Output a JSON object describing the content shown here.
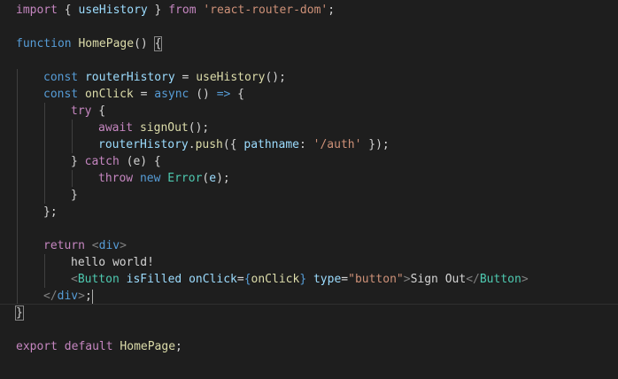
{
  "colors": {
    "background": "#1e1e1e",
    "keyword": "#569cd6",
    "control": "#c586c0",
    "variable": "#9cdcfe",
    "function": "#dcdcaa",
    "string": "#ce9178",
    "class": "#4ec9b0",
    "tag_bracket": "#808080",
    "plain": "#d4d4d4"
  },
  "code": {
    "l1": {
      "kw": "import",
      "p1": " { ",
      "fn": "useHistory",
      "p2": " } ",
      "kw2": "from",
      "sp": " ",
      "str": "'react-router-dom'",
      "end": ";"
    },
    "l3": {
      "kw": "function",
      "sp": " ",
      "fn": "HomePage",
      "p": "() ",
      "brace": "{"
    },
    "l5": {
      "kw": "const",
      "sp": " ",
      "var": "routerHistory",
      "eq": " = ",
      "fn": "useHistory",
      "end": "();"
    },
    "l6": {
      "kw": "const",
      "sp": " ",
      "var": "onClick",
      "eq": " = ",
      "kw2": "async",
      "arrow_pre": " () ",
      "arrow": "=>",
      "brace": " {"
    },
    "l7": {
      "kw": "try",
      "brace": " {"
    },
    "l8": {
      "kw": "await",
      "sp": " ",
      "fn": "signOut",
      "end": "();"
    },
    "l9": {
      "var": "routerHistory",
      "dot": ".",
      "fn": "push",
      "p1": "({ ",
      "prop": "pathname",
      "colon": ": ",
      "str": "'/auth'",
      "end": " });"
    },
    "l10": {
      "pre": "} ",
      "kw": "catch",
      "p": " (",
      "var": "e",
      "end": ") {"
    },
    "l11": {
      "kw": "throw",
      "sp": " ",
      "kw2": "new",
      "sp2": " ",
      "cls": "Error",
      "p": "(",
      "var": "e",
      "end": ");"
    },
    "l12": {
      "brace": "}"
    },
    "l13": {
      "brace": "};"
    },
    "l15": {
      "kw": "return",
      "sp": " ",
      "lt": "<",
      "tag": "div",
      "gt": ">"
    },
    "l16": {
      "text": "hello world!"
    },
    "l17": {
      "lt": "<",
      "tag": "Button",
      "sp1": " ",
      "attr1": "isFilled",
      "sp2": " ",
      "attr2": "onClick",
      "eq": "=",
      "lb": "{",
      "var": "onClick",
      "rb": "}",
      "sp3": " ",
      "attr3": "type",
      "eq2": "=",
      "str": "\"button\"",
      "gt": ">",
      "text": "Sign Out",
      "lt2": "</",
      "tag2": "Button",
      "gt2": ">"
    },
    "l18": {
      "lt": "</",
      "tag": "div",
      "gt": ">",
      "end": ";"
    },
    "l19": {
      "brace": "}"
    },
    "l21": {
      "kw": "export",
      "sp": " ",
      "kw2": "default",
      "sp2": " ",
      "name": "HomePage",
      "end": ";"
    }
  }
}
